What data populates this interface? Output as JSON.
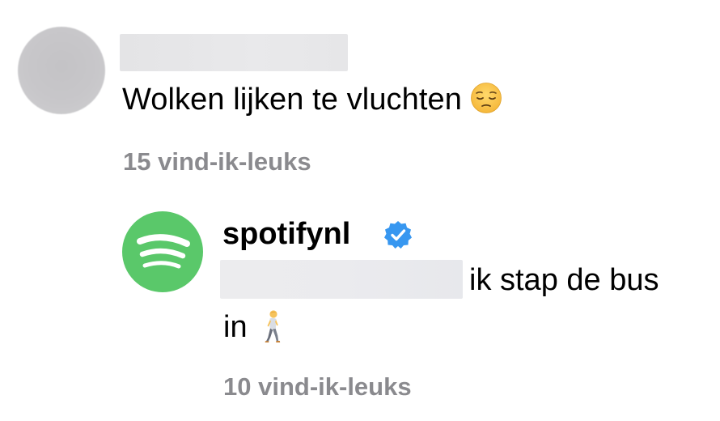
{
  "comment": {
    "text": "Wolken lijken te vluchten",
    "emoji": "pensive-face",
    "likes": "15 vind-ik-leuks"
  },
  "reply": {
    "username": "spotifynl",
    "verified": true,
    "text_line1": "ik stap de bus",
    "text_line2": "in",
    "emoji": "person-walking",
    "likes": "10 vind-ik-leuks"
  },
  "colors": {
    "text": "#000000",
    "secondary_text": "#8a8a8e",
    "spotify_green": "#5ac86a",
    "verified_blue": "#3797f0",
    "redaction_gray": "#e6e6e8"
  }
}
